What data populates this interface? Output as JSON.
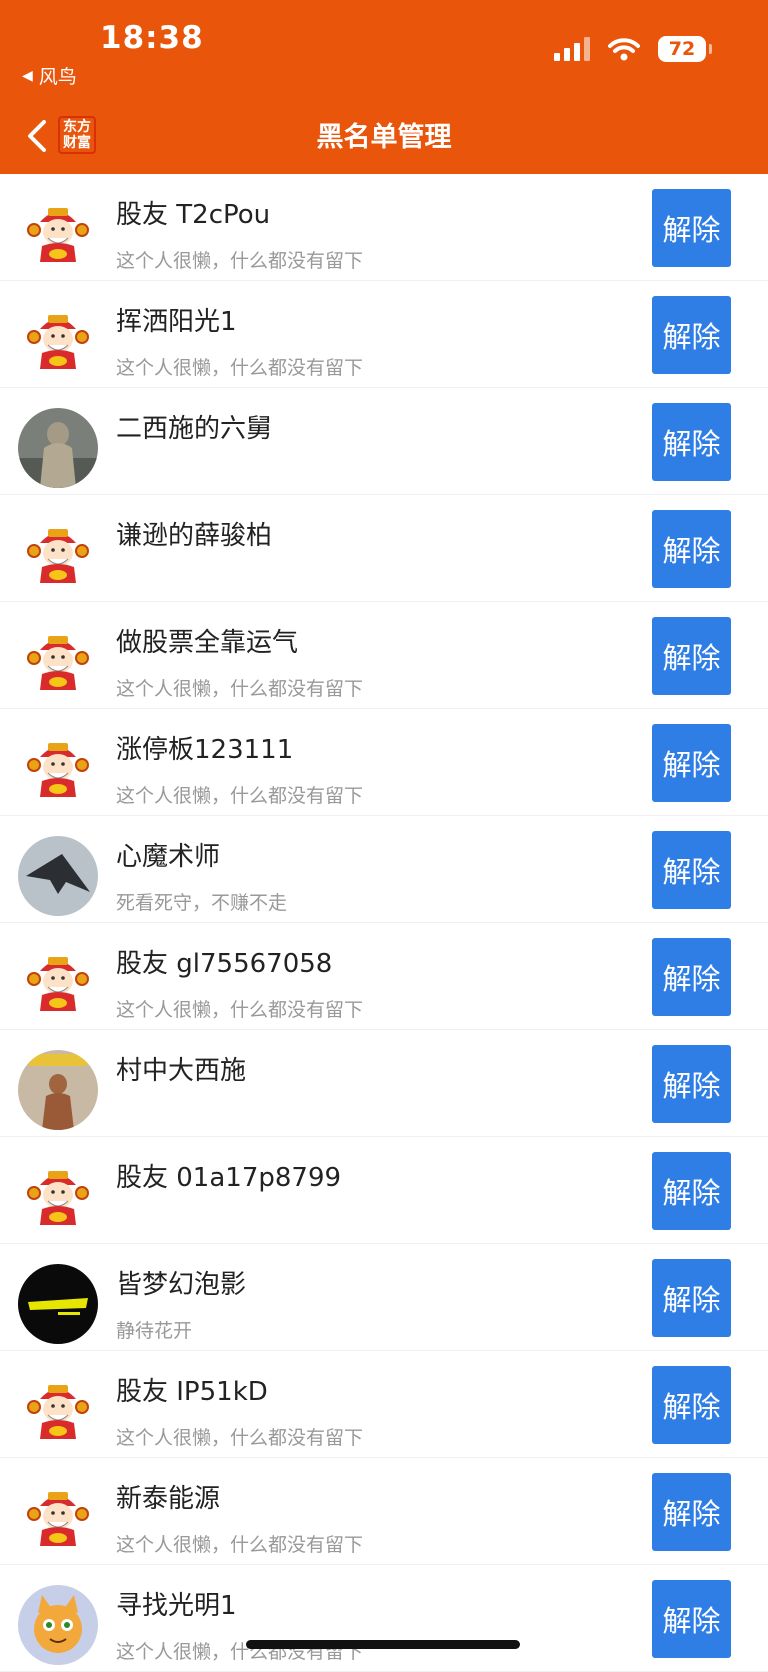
{
  "status_bar": {
    "time": "18:38",
    "back_app": "风鸟",
    "battery": "72"
  },
  "nav": {
    "title": "黑名单管理",
    "logo_line1": "东方",
    "logo_line2": "财富"
  },
  "unblock_label": "解除",
  "colors": {
    "header": "#e8550b",
    "button": "#2f7ee6"
  },
  "users": [
    {
      "name": "股友 T2cPou",
      "signature": "这个人很懒，什么都没有留下",
      "avatar": "caishen-default"
    },
    {
      "name": "挥洒阳光1",
      "signature": "这个人很懒，什么都没有留下",
      "avatar": "caishen-default"
    },
    {
      "name": "二西施的六舅",
      "signature": "",
      "avatar": "photo-person"
    },
    {
      "name": "谦逊的薛骏柏",
      "signature": "",
      "avatar": "caishen-default"
    },
    {
      "name": "做股票全靠运气",
      "signature": "这个人很懒，什么都没有留下",
      "avatar": "caishen-default"
    },
    {
      "name": "涨停板123111",
      "signature": "这个人很懒，什么都没有留下",
      "avatar": "caishen-default"
    },
    {
      "name": "心魔术师",
      "signature": "死看死守，不赚不走",
      "avatar": "photo-aircraft"
    },
    {
      "name": "股友 gl75567058",
      "signature": "这个人很懒，什么都没有留下",
      "avatar": "caishen-default"
    },
    {
      "name": "村中大西施",
      "signature": "",
      "avatar": "photo-meme"
    },
    {
      "name": "股友 01a17p8799",
      "signature": "",
      "avatar": "caishen-default"
    },
    {
      "name": "皆梦幻泡影",
      "signature": "静待花开",
      "avatar": "cyberpunk-logo"
    },
    {
      "name": "股友 IP51kD",
      "signature": "这个人很懒，什么都没有留下",
      "avatar": "caishen-default"
    },
    {
      "name": "新泰能源",
      "signature": "这个人很懒，什么都没有留下",
      "avatar": "caishen-default"
    },
    {
      "name": "寻找光明1",
      "signature": "这个人很懒，什么都没有留下",
      "avatar": "cartoon-cat"
    }
  ]
}
